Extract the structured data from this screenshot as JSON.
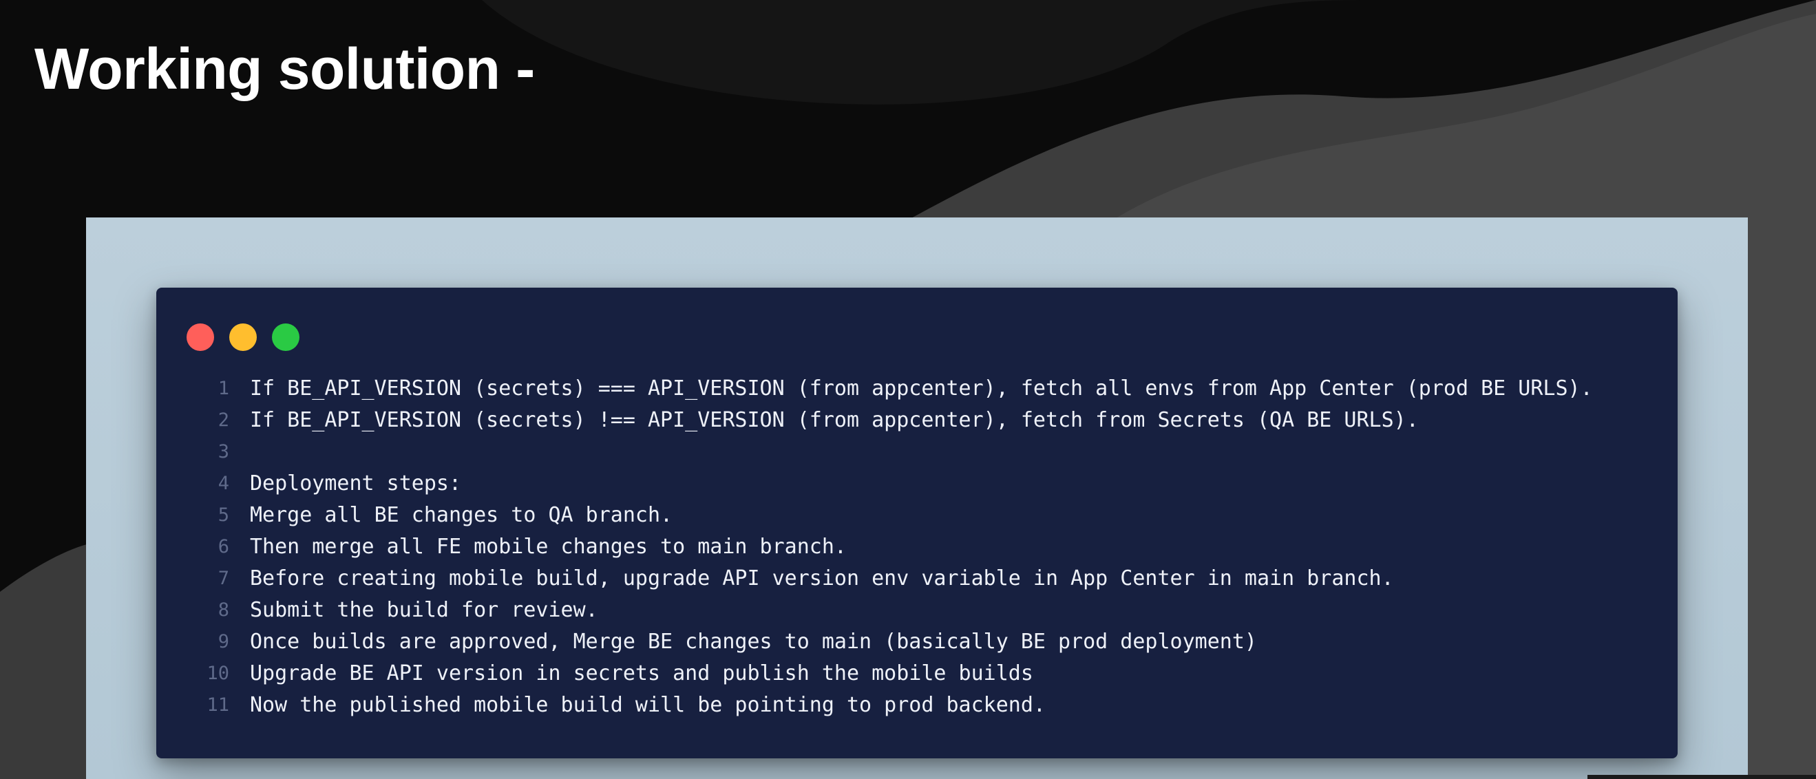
{
  "slide": {
    "title": "Working solution -"
  },
  "window_controls": {
    "close_color": "#ff5f5a",
    "minimize_color": "#ffbe2e",
    "maximize_color": "#2aca44"
  },
  "code": {
    "lines": [
      {
        "number": "1",
        "text": "If BE_API_VERSION (secrets) === API_VERSION (from appcenter), fetch all envs from App Center (prod BE URLS)."
      },
      {
        "number": "2",
        "text": "If BE_API_VERSION (secrets) !== API_VERSION (from appcenter), fetch from Secrets (QA BE URLS)."
      },
      {
        "number": "3",
        "text": ""
      },
      {
        "number": "4",
        "text": "Deployment steps:"
      },
      {
        "number": "5",
        "text": "Merge all BE changes to QA branch."
      },
      {
        "number": "6",
        "text": "Then merge all FE mobile changes to main branch."
      },
      {
        "number": "7",
        "text": "Before creating mobile build, upgrade API version env variable in App Center in main branch."
      },
      {
        "number": "8",
        "text": "Submit the build for review."
      },
      {
        "number": "9",
        "text": "Once builds are approved, Merge BE changes to main (basically BE prod deployment)"
      },
      {
        "number": "10",
        "text": "Upgrade BE API version in secrets and publish the mobile builds"
      },
      {
        "number": "11",
        "text": "Now the published mobile build will be pointing to prod backend."
      }
    ]
  },
  "colors": {
    "code_background": "#172040",
    "frame_background": "#bccfdb",
    "slide_background": "#0b0b0b"
  }
}
